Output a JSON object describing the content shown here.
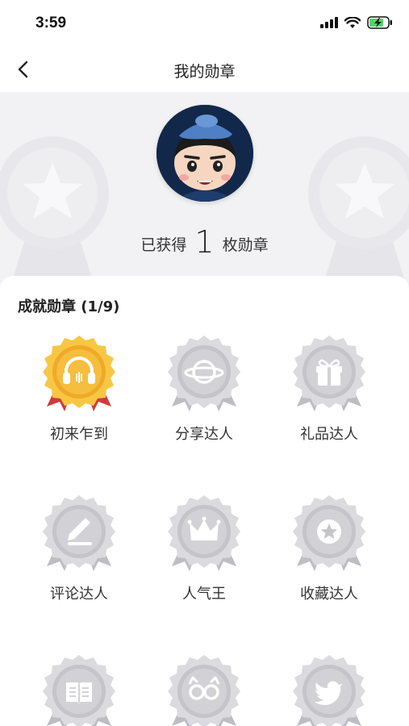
{
  "status_bar": {
    "time": "3:59"
  },
  "nav": {
    "title": "我的勋章"
  },
  "profile": {
    "earned_prefix": "已获得",
    "earned_count": "1",
    "earned_suffix": "枚勋章"
  },
  "badges": {
    "title": "成就勋章 (1/9)",
    "items": [
      {
        "label": "初来乍到",
        "icon": "headphones-icon",
        "earned": true
      },
      {
        "label": "分享达人",
        "icon": "planet-icon",
        "earned": false
      },
      {
        "label": "礼品达人",
        "icon": "gift-icon",
        "earned": false
      },
      {
        "label": "评论达人",
        "icon": "pencil-icon",
        "earned": false
      },
      {
        "label": "人气王",
        "icon": "crown-icon",
        "earned": false
      },
      {
        "label": "收藏达人",
        "icon": "star-icon",
        "earned": false
      },
      {
        "label": "",
        "icon": "book-icon",
        "earned": false
      },
      {
        "label": "",
        "icon": "glasses-cat-icon",
        "earned": false
      },
      {
        "label": "",
        "icon": "bird-icon",
        "earned": false
      }
    ]
  },
  "colors": {
    "gold": "#f5b734",
    "silver": "#d2d2d6",
    "header_bg": "#f2f2f5"
  }
}
